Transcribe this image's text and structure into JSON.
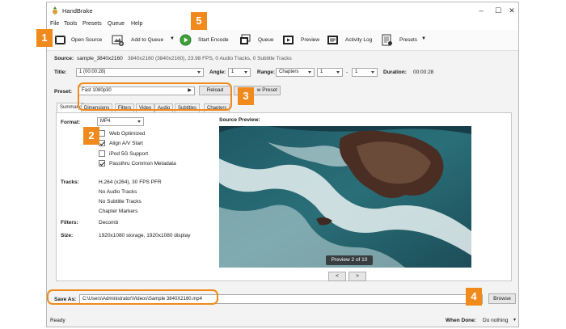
{
  "window": {
    "title": "HandBrake",
    "controls": {
      "minimize": "–",
      "maximize": "☐",
      "close": "✕"
    }
  },
  "menu": [
    "File",
    "Tools",
    "Presets",
    "Queue",
    "Help"
  ],
  "toolbar": {
    "open_source": "Open Source",
    "add_to_queue": "Add to Queue",
    "start_encode": "Start Encode",
    "queue": "Queue",
    "preview": "Preview",
    "activity_log": "Activity Log",
    "presets": "Presets"
  },
  "source": {
    "label": "Source:",
    "name": "sample_3840x2160",
    "details": "3840x2160 (3840x2160), 23.98 FPS, 0 Audio Tracks, 0 Subtitle Tracks"
  },
  "title_row": {
    "title_label": "Title:",
    "title_value": "1 (00:00:28)",
    "angle_label": "Angle:",
    "angle_value": "1",
    "range_label": "Range:",
    "range_value": "Chapters",
    "range_start": "1",
    "range_sep": "-",
    "range_end": "1",
    "duration_label": "Duration:",
    "duration_value": "00:00:28"
  },
  "preset": {
    "label": "Preset:",
    "value": "Fast 1080p30",
    "reload": "Reload",
    "save_new": "Save New Preset",
    "save_new_visible": "w Preset"
  },
  "tabs": [
    "Summary",
    "Dimensions",
    "Filters",
    "Video",
    "Audio",
    "Subtitles",
    "Chapters"
  ],
  "summary": {
    "format_label": "Format:",
    "format_value": "MP4",
    "options": [
      {
        "label": "Web Optimized",
        "checked": false
      },
      {
        "label": "Align A/V Start",
        "checked": true
      },
      {
        "label": "iPod 5G Support",
        "checked": false
      },
      {
        "label": "Passthru Common Metadata",
        "checked": true
      }
    ],
    "tracks_label": "Tracks:",
    "tracks": [
      "H.264 (x264), 30 FPS PFR",
      "No Audio Tracks",
      "No Subtitle Tracks",
      "Chapter Markers"
    ],
    "filters_label": "Filters:",
    "filters_value": "Decomb",
    "size_label": "Size:",
    "size_value": "1920x1080 storage, 1920x1080 display"
  },
  "preview": {
    "label": "Source Preview:",
    "counter": "Preview 2 of 10",
    "prev": "<",
    "next": ">"
  },
  "save_as": {
    "label": "Save As:",
    "path": "C:\\Users\\Administrator\\Videos\\Sample 3840X2160.mp4",
    "browse": "Browse"
  },
  "status": {
    "text": "Ready",
    "when_done_label": "When Done:",
    "when_done_value": "Do nothing"
  },
  "callouts": [
    "1",
    "2",
    "3",
    "4",
    "5"
  ],
  "colors": {
    "accent": "#f08a1c",
    "start_green": "#3ea13a"
  }
}
